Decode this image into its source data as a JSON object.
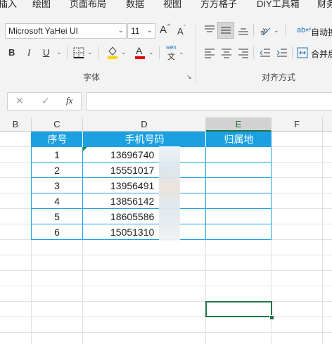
{
  "ribbon": {
    "tabs": [
      "插入",
      "绘图",
      "页面布局",
      "数据",
      "视图",
      "方方格子",
      "DIY工具箱",
      "财务"
    ],
    "font_name": "Microsoft YaHei UI",
    "font_size": "11",
    "grow_font": "A",
    "shrink_font": "A",
    "bold": "B",
    "italic": "I",
    "underline": "U",
    "wen_top": "wén",
    "wen_bottom": "文",
    "font_group_label": "字体",
    "align_group_label": "对齐方式",
    "auto_wrap": "自动换",
    "merge_center": "合并后"
  },
  "formula_bar": {
    "cancel": "✕",
    "enter": "✓",
    "fx": "fx",
    "value": ""
  },
  "columns": [
    "B",
    "C",
    "D",
    "E",
    "F"
  ],
  "table": {
    "headers": [
      "序号",
      "手机号码",
      "归属地"
    ],
    "rows": [
      {
        "no": "1",
        "phone": "13696740"
      },
      {
        "no": "2",
        "phone": "15551017"
      },
      {
        "no": "3",
        "phone": "13956491"
      },
      {
        "no": "4",
        "phone": "13856142"
      },
      {
        "no": "5",
        "phone": "18605586"
      },
      {
        "no": "6",
        "phone": "15051310"
      }
    ]
  },
  "colors": {
    "header_fill": "#1ba1e2",
    "selection": "#217346"
  }
}
